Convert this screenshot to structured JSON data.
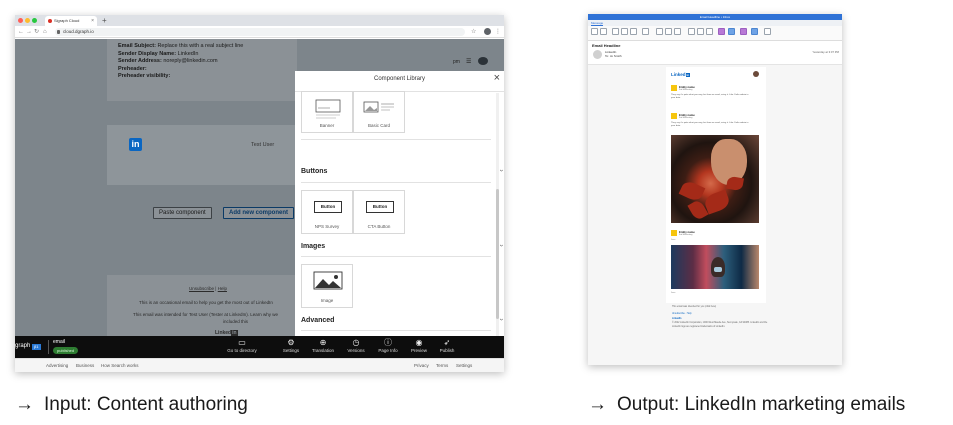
{
  "left": {
    "browser": {
      "tab_title": "Sigraph Cloud",
      "url": "cloud.dgraph.io",
      "newtab": "+"
    },
    "email_meta": {
      "subject_label": "Email Subject:",
      "subject_value": "Replace this with a real subject line",
      "sender_name_label": "Sender Display Name:",
      "sender_name_value": "LinkedIn",
      "sender_address_label": "Sender Address:",
      "sender_address_value": "noreply@linkedin.com",
      "preheader_label": "Preheader:",
      "preheader_visibility_label": "Preheader visibility:"
    },
    "card": {
      "logo_text": "in",
      "test_user": "Test User"
    },
    "actions": {
      "paste": "Paste component",
      "add": "Add new component"
    },
    "footer": {
      "unsubscribe": "Unsubscribe",
      "help": "Help",
      "sep": "|",
      "line1": "This is an occasional email to help you get the most out of LinkedIn",
      "line2": "This email was intended for Test User (Tester at LinkedIn). Learn why we",
      "line3": "included this",
      "brand": "Linked",
      "brand_in": "in",
      "copyright": "© 2022 LinkedIn Corporation, 1000 West Maude Ave, Sunnyvale,"
    },
    "panel": {
      "title": "Component Library",
      "close": "×",
      "chevron": "›",
      "tiles_top": [
        {
          "caption": "Banner",
          "glyph": "Aa"
        },
        {
          "caption": "Basic Card",
          "glyph": "Aa"
        }
      ],
      "sections": [
        {
          "title": "Buttons",
          "tiles": [
            {
              "caption": "NPS Survey",
              "glyph": "Button"
            },
            {
              "caption": "CTA Button",
              "glyph": "Button"
            }
          ]
        },
        {
          "title": "Images",
          "tiles": [
            {
              "caption": "Image",
              "glyph": ""
            }
          ]
        },
        {
          "title": "Advanced",
          "tiles": [
            {
              "caption": "",
              "glyph": "</>"
            },
            {
              "caption": "",
              "glyph": "A/B"
            }
          ]
        }
      ]
    },
    "toolbar": {
      "brand": "graph",
      "brand_tag": "β1",
      "doc_name": "email",
      "status": "published",
      "items": [
        {
          "label": "Go to directory",
          "icon": "▭"
        },
        {
          "label": "Settings",
          "icon": "⚙"
        },
        {
          "label": "Translation",
          "icon": "⊕"
        },
        {
          "label": "Versions",
          "icon": "◷"
        },
        {
          "label": "Page Info",
          "icon": "ⓘ"
        },
        {
          "label": "Preview",
          "icon": "◉"
        },
        {
          "label": "Publish",
          "icon": "➶"
        }
      ]
    },
    "statusbar": {
      "links_left": [
        "Advertising",
        "Business",
        "How Search works"
      ],
      "links_right": [
        "Privacy",
        "Terms",
        "Settings"
      ]
    },
    "caption": "Input: Content authoring"
  },
  "right": {
    "window_title": "Email Headline • Inbox",
    "ribbon_tab": "Message",
    "subject": "Email Headline",
    "from": "LinkedIn",
    "to": "To: Jo Smith",
    "date": "Yesterday at 3:07 PM",
    "body_brand": "Linked",
    "body_brand_in": "in",
    "post_name": "Entity name",
    "post_sub": "3rd Marketing",
    "post_text": "They say it's quite what you way, but how we send, using it. Like: Delta admin in your data.",
    "photo_caption": "Jess",
    "foot_1": "This email was intended for you (click here)",
    "foot_link": "Unsubscribe · Help",
    "foot_brand": "LinkedIn",
    "foot_copy": "© 2022 LinkedIn Corporation, 1000 West Maude Ave, Sunnyvale, CA 94085. LinkedIn and the LinkedIn logo are registered trademarks of LinkedIn.",
    "caption": "Output: LinkedIn marketing emails"
  },
  "colors": {
    "linkedin_blue": "#0a66c2",
    "toolbar_bg": "#0d0d0d",
    "published_green": "#2e7d32",
    "overlay_gray": "#7d858b",
    "mail_title_blue": "#2f72d6"
  }
}
